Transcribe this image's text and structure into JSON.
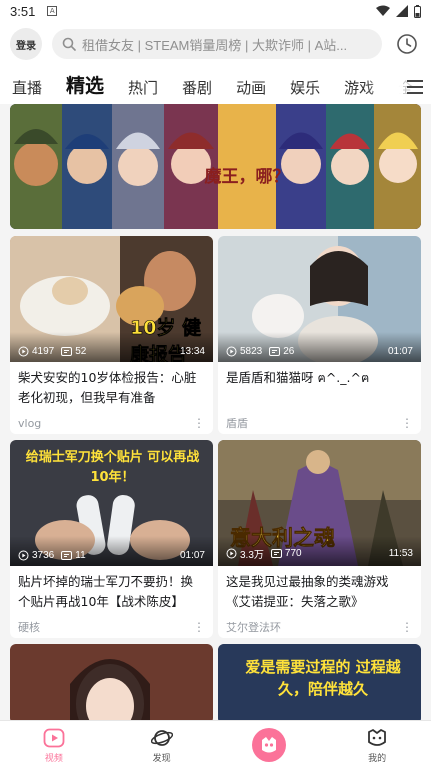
{
  "status": {
    "time": "3:51",
    "badge": "A"
  },
  "header": {
    "login_label": "登录",
    "search_placeholder": "租借女友 | STEAM销量周榜 | 大欺诈师 | A站..."
  },
  "tabs": [
    "直播",
    "精选",
    "热门",
    "番剧",
    "动画",
    "娱乐",
    "游戏",
    "全"
  ],
  "active_tab": "精选",
  "banner": {
    "logo_text": "魔王，哪？"
  },
  "cards": [
    {
      "views": "4197",
      "danmaku": "52",
      "duration": "13:34",
      "title": "柴犬安安的10岁体检报告：心脏老化初现，但我早有准备",
      "author": "vlog",
      "overlay": "10岁 健康报告"
    },
    {
      "views": "5823",
      "danmaku": "26",
      "duration": "01:07",
      "title": "是盾盾和猫猫呀 ฅ^._.^ฅ",
      "author": "盾盾",
      "overlay": ""
    },
    {
      "views": "3736",
      "danmaku": "11",
      "duration": "01:07",
      "title": "贴片坏掉的瑞士军刀不要扔！换个贴片再战10年【战术陈皮】",
      "author": "硬核",
      "overlay": "给瑞士军刀换个贴片 可以再战10年！"
    },
    {
      "views": "3.3万",
      "danmaku": "770",
      "duration": "11:53",
      "title": "这是我见过最抽象的类魂游戏《艾诺提亚：失落之歌》",
      "author": "艾尔登法环",
      "overlay": "意大利之魂"
    },
    {
      "overlay": ""
    },
    {
      "overlay": "爱是需要过程的 过程越久，陪伴越久"
    }
  ],
  "bottom_nav": [
    {
      "label": "视频",
      "icon": "play-icon",
      "active": true
    },
    {
      "label": "发现",
      "icon": "planet-icon",
      "active": false
    },
    {
      "label": "",
      "icon": "brand-icon",
      "active": false
    },
    {
      "label": "我的",
      "icon": "avatar-icon",
      "active": false
    }
  ],
  "colors": {
    "accent": "#fb7299",
    "bg": "#f4f4f4"
  }
}
